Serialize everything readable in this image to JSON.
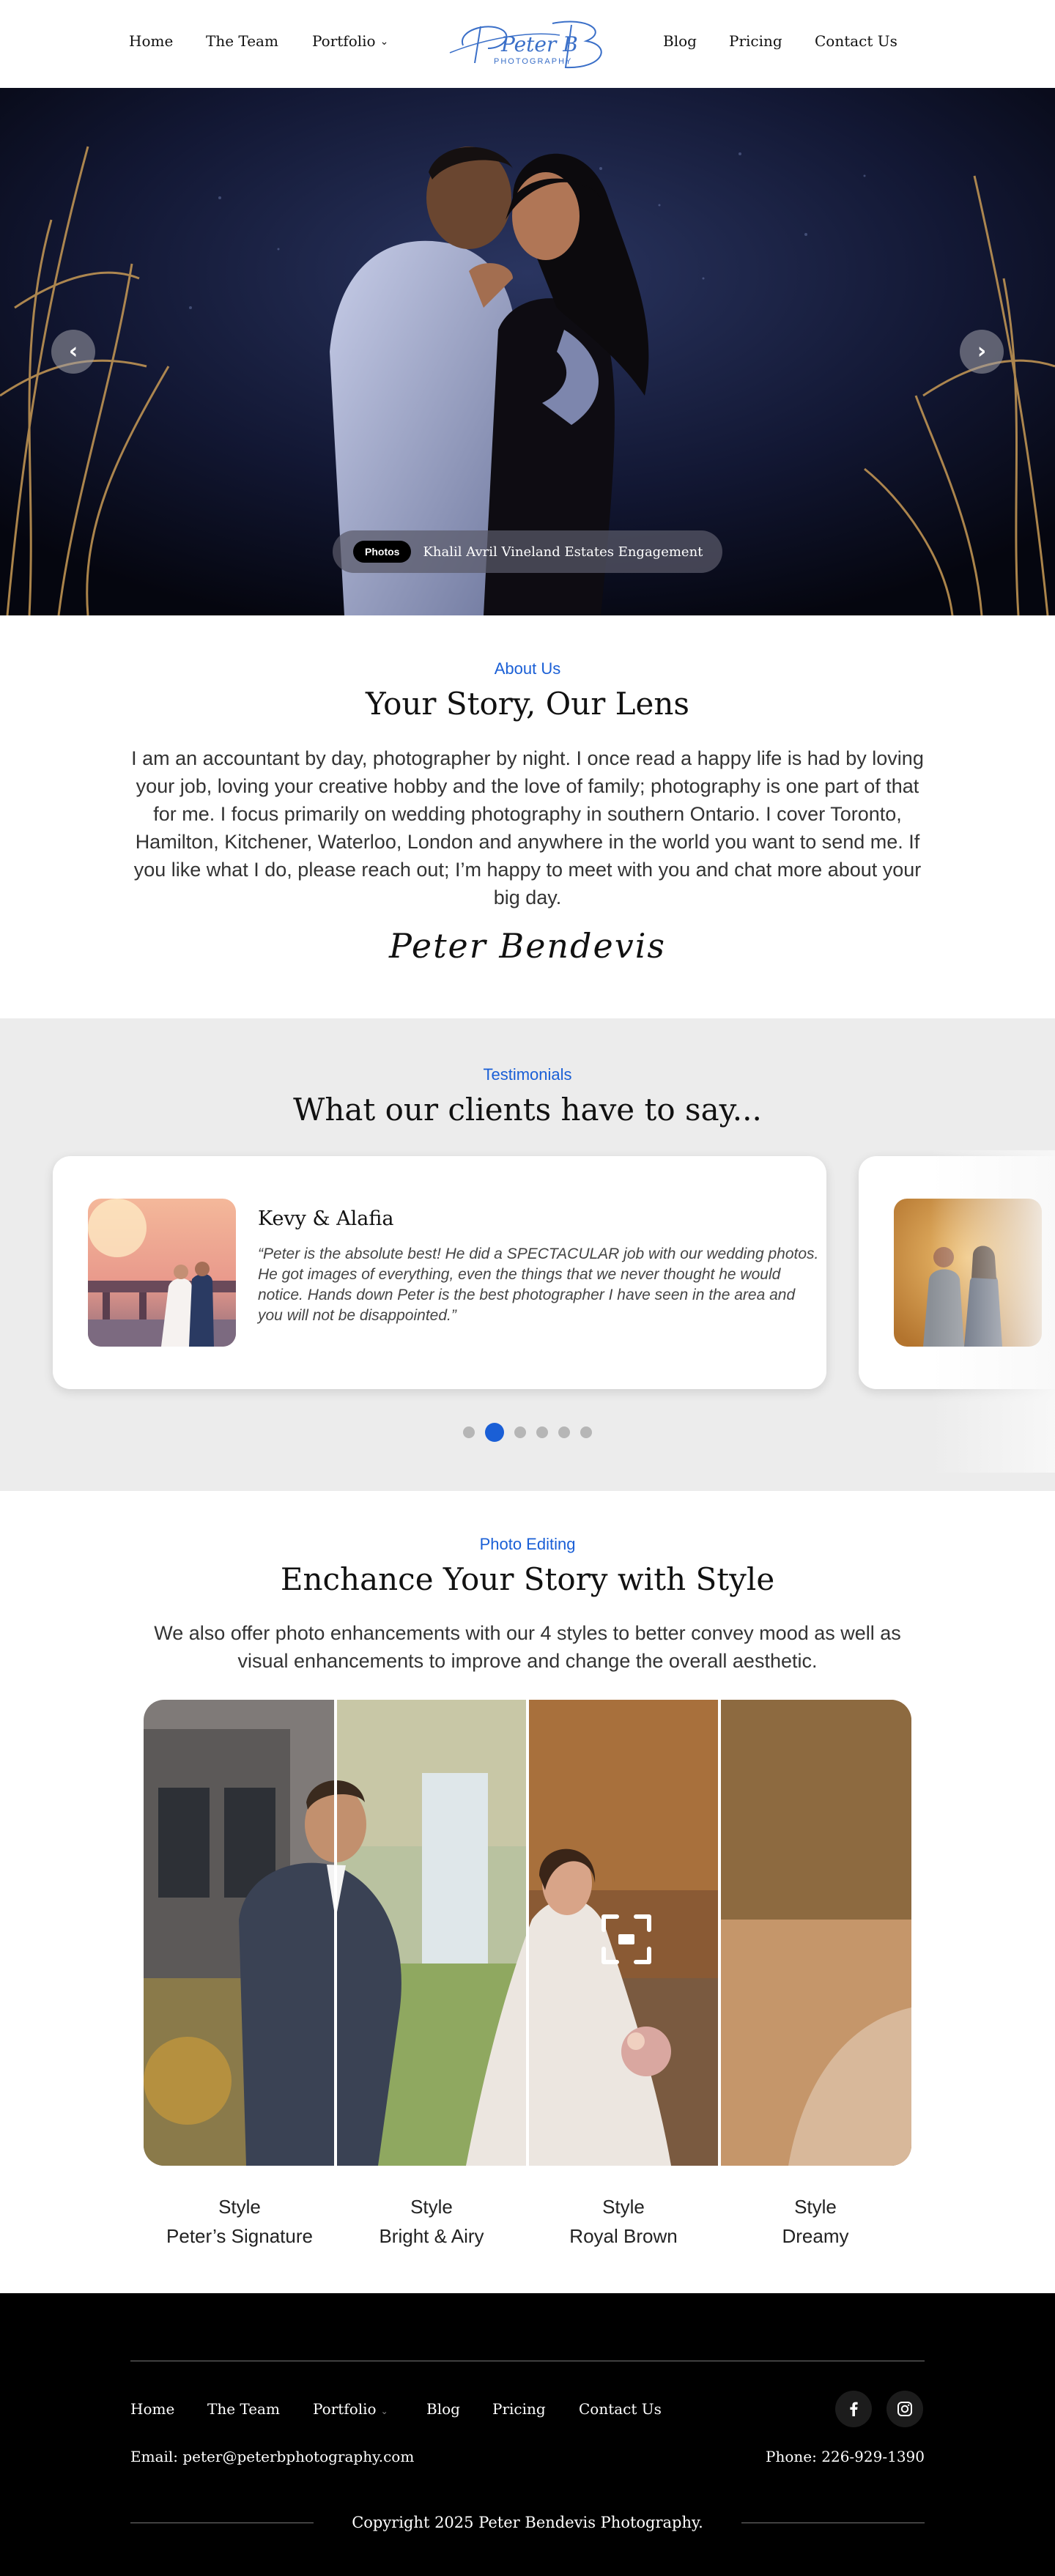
{
  "nav": {
    "home": "Home",
    "team": "The Team",
    "portfolio": "Portfolio",
    "blog": "Blog",
    "pricing": "Pricing",
    "contact": "Contact Us",
    "logo_script": "Peter B",
    "logo_sub": "PHOTOGRAPHY"
  },
  "hero": {
    "badge": "Photos",
    "title": "Khalil Avril Vineland Estates Engagement",
    "prev_icon": "chevron-left-icon",
    "next_icon": "chevron-right-icon"
  },
  "about": {
    "eyebrow": "About Us",
    "heading": "Your Story, Our Lens",
    "text": "I am an accountant by day, photographer by night. I once read a happy life is had by loving your job, loving your creative hobby and the love of family; photography is one part of that for me. I focus primarily on wedding photography in southern Ontario. I cover Toronto, Hamilton, Kitchener, Waterloo, London and anywhere in the world you want to send me. If you like what I do, please reach out; I’m happy to meet with you and chat more about your big day.",
    "signature": "Peter Bendevis"
  },
  "testimonials": {
    "eyebrow": "Testimonials",
    "heading": "What our clients have to say...",
    "items": [
      {
        "name": "Kevy & Alafia",
        "quote": "“Peter is the absolute best! He did a SPECTACULAR job with our wedding photos. He got images of everything, even the things that we never thought he would notice. Hands down Peter is the best photographer I have seen in the area and you will not be disappointed.”"
      }
    ],
    "dots_total": 6,
    "active_dot": 2
  },
  "editing": {
    "eyebrow": "Photo Editing",
    "heading": "Enchance Your Story with Style",
    "text": "We also offer photo enhancements with our 4 styles to better convey mood as well as visual enhancements to improve and change the overall aesthetic.",
    "styles": [
      {
        "label": "Style",
        "name": "Peter’s Signature"
      },
      {
        "label": "Style",
        "name": "Bright & Airy"
      },
      {
        "label": "Style",
        "name": "Royal Brown"
      },
      {
        "label": "Style",
        "name": "Dreamy"
      }
    ],
    "fullscreen_icon": "expand-icon"
  },
  "footer": {
    "home": "Home",
    "team": "The Team",
    "portfolio": "Portfolio",
    "blog": "Blog",
    "pricing": "Pricing",
    "contact": "Contact Us",
    "email": "Email: peter@peterbphotography.com",
    "phone": "Phone: 226-929-1390",
    "copyright": "Copyright 2025 Peter Bendevis Photography.",
    "social": [
      "facebook-icon",
      "instagram-icon"
    ]
  },
  "colors": {
    "accent": "#1a5fd6",
    "footer_bg": "#000000",
    "testimonial_bg": "#ececec"
  }
}
